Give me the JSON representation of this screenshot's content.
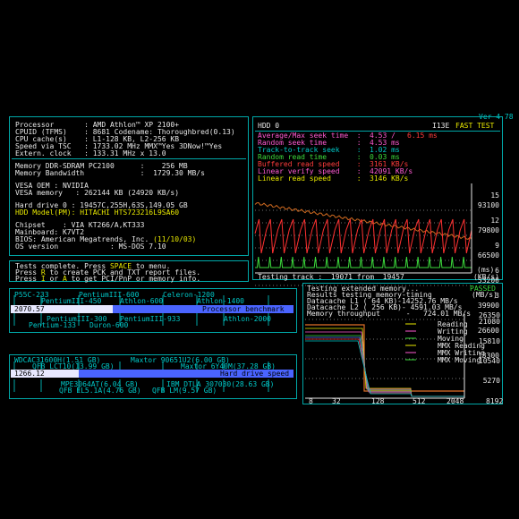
{
  "version": "Ver 4.78",
  "system": {
    "processor": "Processor       : AMD Athlon™ XP 2100+",
    "cpuid": "CPUID (TFMS)    : 8681 Codename: Thoroughbred(0.13)",
    "cache": "CPU cache(s)    : L1-128 KB, L2-256 KB",
    "speed": "Speed via TSC   : 1733.02 MHz MMX™Yes 3DNow!™Yes",
    "clock": "Extern. clock   : 133.31 MHz x 13.0",
    "memory": "Memory DDR-SDRAM PC2100      :    256 MB",
    "bandwidth": "Memory Bandwidth             :  1729.30 MB/s",
    "vesa_oem": "VESA OEM : NVIDIA",
    "vesa_mem": "VESA memory   : 262144 KB (24920 KB/s)",
    "hdd": "Hard drive 0 : 19457C,255H,63S,149.05 GB",
    "hdd_model": "HDD Model(PM): HITACHI HTS723216L9SA60",
    "chipset": "Chipset    : VIA KT266/A,KT333",
    "mainboard": "Mainboard: K7VT2",
    "bios_prefix": "BIOS: American Megatrends, Inc. ",
    "bios_date": "(11/10/03)",
    "os": "OS version            : MS-DOS 7.10"
  },
  "messages": {
    "line1_a": "Tests complete. Press ",
    "line1_key": "SPACE",
    "line1_b": " to menu.",
    "line2_a": "Press ",
    "line2_key": "R",
    "line2_b": " to create PCK and TXT report files.",
    "line3_a": "Press ",
    "line3_key": "I",
    "line3_b": " or ",
    "line3_key2": "A",
    "line3_c": " to get PCI/PnP or memory info."
  },
  "hdd_test": {
    "title": "HDD 0",
    "mode": "I13E",
    "fast": "FAST TEST",
    "avg_label": "Average/Max seek time  :",
    "avg_value": "4.53 /",
    "avg_max": "6.15 ms",
    "random_label": "Random seek time       :",
    "random_value": "4.53 ms",
    "t2t_label": "Track-to-track seek    :",
    "t2t_value": "1.02 ms",
    "random_read_label": "Random read time       :",
    "random_read_value": "0.03 ms",
    "buffered_label": "Buffered read speed    :",
    "buffered_value": "3161 KB/s",
    "verify_label": "Linear verify speed    :",
    "verify_value": "42091 KB/s",
    "linear_label": "Linear read speed      :",
    "linear_value": "3146 KB/s",
    "ms_labels": [
      "15",
      "12",
      "9",
      "6",
      "3"
    ],
    "ms_unit": "(ms)",
    "kb_labels": [
      "93100",
      "79800",
      "66500",
      "53200",
      "39900",
      "26600",
      "13300"
    ],
    "kb_unit": "(KB/s)",
    "status": "Testing track :  19071 from  19457"
  },
  "memory_test": {
    "title": "Testing extended memory...",
    "passed": "PASSED",
    "results": "Results testing memory-timing",
    "unit": "(MB/s)",
    "l1": "Datacache L1 ( 64 KB)-14252.76 MB/s",
    "l2": "Datacache L2 ( 256 KB)- 4591.03 MB/s",
    "throughput": "Memory throughput      -   724.01 MB/s",
    "y_labels": [
      "21080",
      "15810",
      "10540",
      "5270"
    ],
    "top_label": "26350",
    "x_labels": [
      "8",
      "32",
      "128",
      "512",
      "2048",
      "8192"
    ],
    "legend": [
      "Reading",
      "Writing",
      "Moving",
      "MMX Reading",
      "MMX Writing",
      "MMX Moving"
    ],
    "legend_colors": [
      "#e8e800",
      "#ff5ad2",
      "#3cdc3c",
      "#e8e800",
      "#ff5ad2",
      "#3cdc3c"
    ]
  },
  "cpu_bench": {
    "top_labels": [
      "P55C-233",
      "PentiumIII-600",
      "Celeron-1200"
    ],
    "row2_labels": [
      "PentiumIII-450",
      "Athlon-600",
      "Athlon-1400"
    ],
    "value": "2070.57",
    "caption": "Processor benchmark",
    "bottom1": [
      "PentiumIII-300",
      "PentiumIII-933",
      "Athlon-2000"
    ],
    "bottom2": [
      "Pentium-133",
      "Duron-600"
    ],
    "progress": 0.36
  },
  "hdd_bench": {
    "top1": [
      "WDCAC31600H(1.51 GB)",
      "Maxtor 90651U2(6.00 GB)"
    ],
    "top2": [
      "QFB LCT10(13.99 GB)",
      "Maxtor 6Y40M(37.28 GB)"
    ],
    "value": "1266.12",
    "caption": "Hard drive speed",
    "bottom1": [
      "MPE3064AT(6.04 GB)",
      "IBM DTLA 307030(28.63 GB)"
    ],
    "bottom2": [
      "QFB EL5.1A(4.76 GB)",
      "QFB LM(9.57 GB)"
    ],
    "progress": 0.24
  },
  "colors": {
    "frame": "#00a8a8",
    "bar_fill": "#4a64ff",
    "accent_cyan": "#00c8c8"
  }
}
